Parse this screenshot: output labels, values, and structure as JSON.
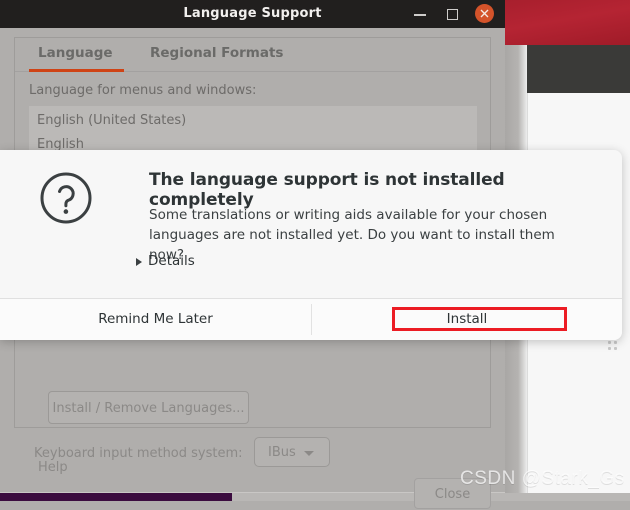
{
  "window": {
    "title": "Language Support",
    "controls": {
      "minimize": "minimize",
      "maximize": "maximize",
      "close": "close"
    },
    "tabs": [
      {
        "label": "Language",
        "active": true
      },
      {
        "label": "Regional Formats",
        "active": false
      }
    ],
    "language_section": {
      "label": "Language for menus and windows:",
      "items": [
        "English (United States)",
        "English"
      ]
    },
    "install_remove_button": "Install / Remove Languages...",
    "keyboard_label": "Keyboard input method system:",
    "keyboard_value": "IBus",
    "help_label": "Help",
    "close_label": "Close"
  },
  "dialog": {
    "icon": "question-mark-icon",
    "heading": "The language support is not installed completely",
    "body": "Some translations or writing aids available for your chosen languages are not installed yet. Do you want to install them now?",
    "details_label": "Details",
    "buttons": {
      "remind": "Remind Me Later",
      "install": "Install"
    }
  },
  "annotation": {
    "highlight_target": "Install",
    "highlight_color": "#ec1c24"
  },
  "watermark": "CSDN @Stark_Gs",
  "colors": {
    "accent_orange": "#cf4315",
    "window_chrome": "#211f1e",
    "close_button": "#d4532a",
    "desktop_red": "#b52433",
    "taskbar_purple": "#3b0c3f"
  }
}
